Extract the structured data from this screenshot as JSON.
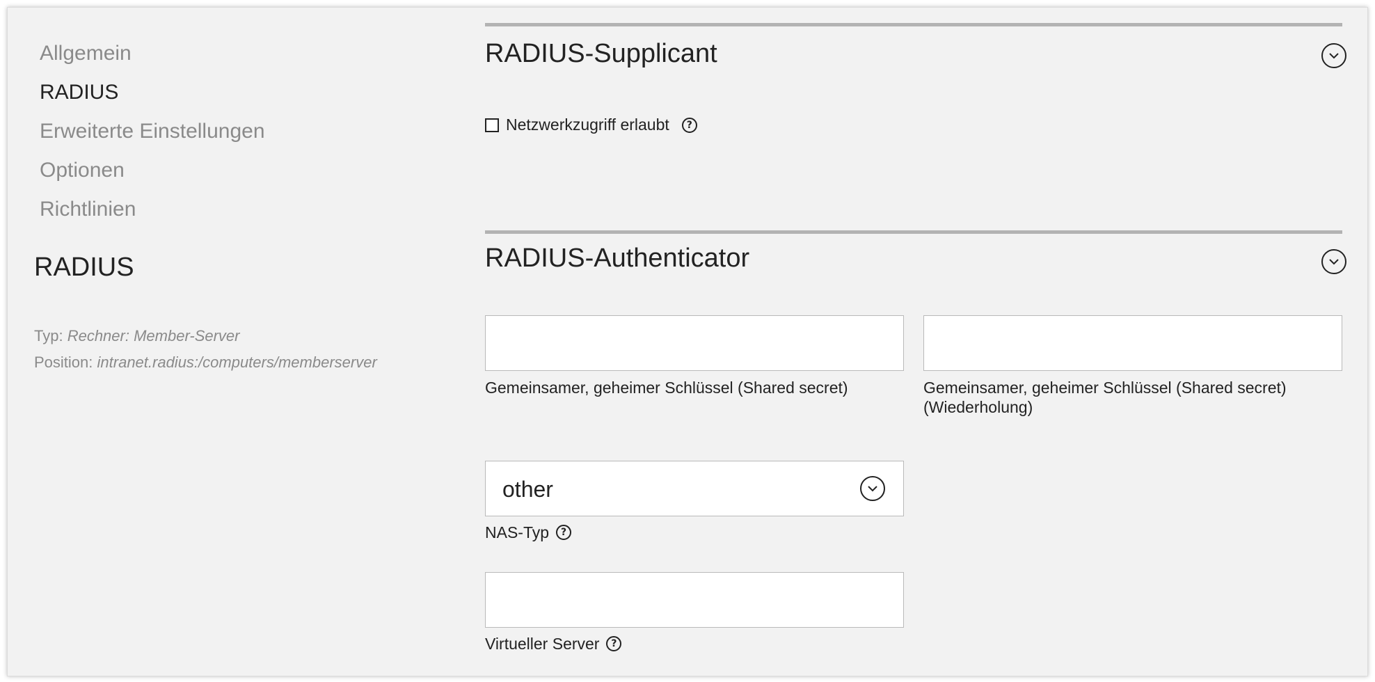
{
  "nav": {
    "items": [
      {
        "label": "Allgemein",
        "active": false
      },
      {
        "label": "RADIUS",
        "active": true
      },
      {
        "label": "Erweiterte Einstellungen",
        "active": false
      },
      {
        "label": "Optionen",
        "active": false
      },
      {
        "label": "Richtlinien",
        "active": false
      }
    ]
  },
  "sidebar": {
    "title": "RADIUS",
    "type_label": "Typ:",
    "type_value": "Rechner: Member-Server",
    "position_label": "Position:",
    "position_value": "intranet.radius:/computers/memberserver"
  },
  "supplicant": {
    "title": "RADIUS-Supplicant",
    "network_access_label": "Netzwerkzugriff erlaubt",
    "network_access_checked": false,
    "help_icon": "question-circle-icon",
    "toggle_icon": "chevron-down-circle-icon"
  },
  "authenticator": {
    "title": "RADIUS-Authenticator",
    "toggle_icon": "chevron-down-circle-icon",
    "shared_secret": {
      "label": "Gemeinsamer, geheimer Schlüssel (Shared secret)",
      "value": ""
    },
    "shared_secret_repeat": {
      "label_line1": "Gemeinsamer, geheimer Schlüssel (Shared secret)",
      "label_line2": "(Wiederholung)",
      "value": ""
    },
    "nas_type": {
      "label": "NAS-Typ",
      "selected": "other"
    },
    "virtual_server": {
      "label": "Virtueller Server",
      "value": ""
    }
  },
  "colors": {
    "panel_background": "#f2f2f2",
    "section_rule": "#b3b3b3",
    "muted_text": "#8a8a8a",
    "text": "#222222"
  }
}
